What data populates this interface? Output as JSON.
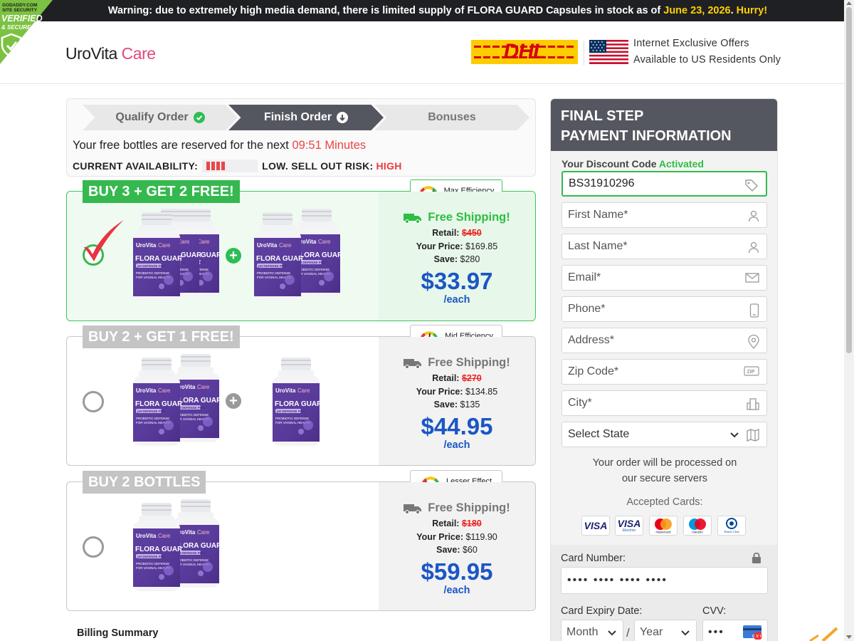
{
  "topbar": {
    "warning_prefix": "Warning: due to extremely high media demand, there is limited supply of FLORA GUARD Capsules in stock as of ",
    "date": "June 23, 2026",
    "suffix": ". ",
    "hurry": "Hurry!"
  },
  "badge": {
    "line1": "GODADDY.COM",
    "line2": "SITE SECURITY",
    "line3": "VERIFIED",
    "line4": "& SECURE"
  },
  "header": {
    "logo_main": "UroVita",
    "logo_accent": "Care",
    "shipper": "DHL",
    "offer_line1": "Internet Exclusive Offers",
    "offer_line2": "Available to US Residents Only"
  },
  "progress": {
    "steps": [
      "Qualify Order",
      "Finish Order",
      "Bonuses"
    ],
    "reserve_text": "Your free bottles are reserved for the next ",
    "timer": "09:51 Minutes",
    "availability_label": "CURRENT AVAILABILITY:",
    "availability_level": "LOW.",
    "risk_label": "SELL OUT RISK:",
    "risk_value": "HIGH",
    "meter_fill": 0.5
  },
  "product": {
    "brand": "UroVita Care",
    "name": "FLORA GUARD",
    "tag": "pH DEFENSE PRO",
    "desc": "PROBIOTIC DEFENSE FOR VAGINAL HEALTH"
  },
  "offers": [
    {
      "label": "BUY 3 + GET 2 FREE!",
      "efficiency": "Max Efficiency",
      "shipping": "Free Shipping!",
      "retail_label": "Retail:",
      "retail": "$450",
      "your_price_label": "Your Price:",
      "your_price": "$169.85",
      "save_label": "Save:",
      "save": "$280",
      "per_each": "$33.97",
      "each_label": "/each",
      "selected": true
    },
    {
      "label": "BUY 2 + GET 1 FREE!",
      "efficiency": "Mid Efficiency",
      "shipping": "Free Shipping!",
      "retail_label": "Retail:",
      "retail": "$270",
      "your_price_label": "Your Price:",
      "your_price": "$134.85",
      "save_label": "Save:",
      "save": "$135",
      "per_each": "$44.95",
      "each_label": "/each",
      "selected": false
    },
    {
      "label": "BUY 2 BOTTLES",
      "efficiency": "Lesser Effect",
      "shipping": "Free Shipping!",
      "retail_label": "Retail:",
      "retail": "$180",
      "your_price_label": "Your Price:",
      "your_price": "$119.90",
      "save_label": "Save:",
      "save": "$60",
      "per_each": "$59.95",
      "each_label": "/each",
      "selected": false
    }
  ],
  "billing_summary": "Billing Summary",
  "payment": {
    "title_line1": "FINAL STEP",
    "title_line2": "PAYMENT INFORMATION",
    "discount_label": "Your Discount Code ",
    "discount_status": "Activated",
    "discount_code": "BS31910296",
    "first_name": "First Name*",
    "last_name": "Last Name*",
    "email": "Email*",
    "phone": "Phone*",
    "address": "Address*",
    "zip": "Zip Code*",
    "city": "City*",
    "state": "Select State",
    "secure_line1": "Your order will be processed on",
    "secure_line2": "our secure servers",
    "accepted_cards": "Accepted Cards:",
    "card_brands": [
      "VISA",
      "VISA",
      "mastercard",
      "maestro",
      "Diners Club"
    ],
    "card_number_label": "Card Number:",
    "card_number_placeholder": "•••• •••• •••• ••••",
    "expiry_label": "Card Expiry Date:",
    "month": "Month",
    "year": "Year",
    "cvv_label": "CVV:",
    "cvv_placeholder": "•••"
  },
  "colors": {
    "accent_green": "#35b94f",
    "price_blue": "#1b56c5",
    "alert_red": "#ec4545",
    "brand_pink": "#e6477e",
    "dark_header": "#54575f"
  }
}
